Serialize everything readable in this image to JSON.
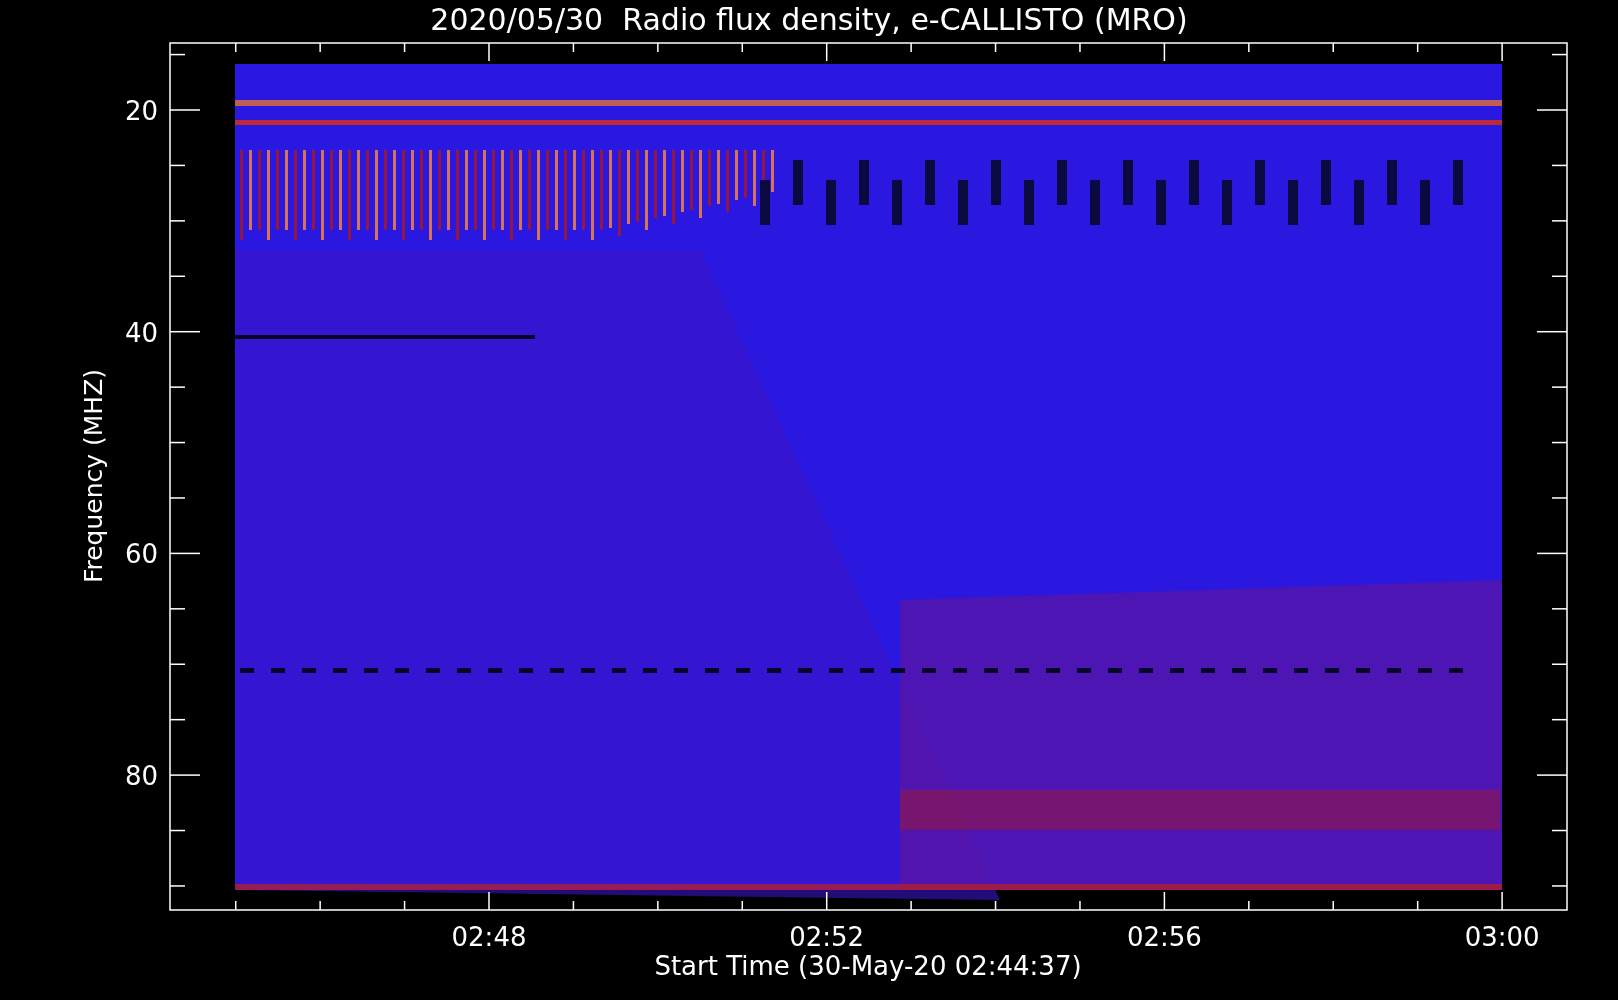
{
  "title": "2020/05/30  Radio flux density, e-CALLISTO (MRO)",
  "y_axis": {
    "label": "Frequency (MHZ)",
    "ticks": [
      "20",
      "40",
      "60",
      "80"
    ]
  },
  "x_axis": {
    "label": "Start Time (30-May-20 02:44:37)",
    "ticks": [
      "02:48",
      "02:52",
      "02:56",
      "03:00"
    ]
  }
}
